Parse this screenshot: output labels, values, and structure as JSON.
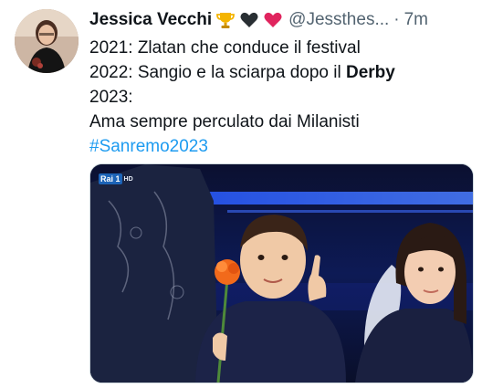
{
  "tweet": {
    "author": {
      "display_name": "Jessica Vecchi",
      "handle": "@Jessthes...",
      "emojis": [
        "trophy-emoji",
        "black-heart-emoji",
        "red-heart-emoji"
      ]
    },
    "separator": "·",
    "timestamp": "7m",
    "lines": {
      "l1": "2021: Zlatan che conduce il festival",
      "l2_prefix": "2022: Sangio e la sciarpa dopo il ",
      "l2_bold": "Derby",
      "l3": "2023:",
      "l4": "Ama sempre perculato dai Milanisti"
    },
    "hashtag": "#Sanremo2023",
    "media": {
      "watermark": "Rai 1",
      "watermark_hd": "HD"
    }
  },
  "colors": {
    "text": "#0f1419",
    "secondary": "#536471",
    "link": "#1d9bf0",
    "border": "#cfd9de"
  }
}
